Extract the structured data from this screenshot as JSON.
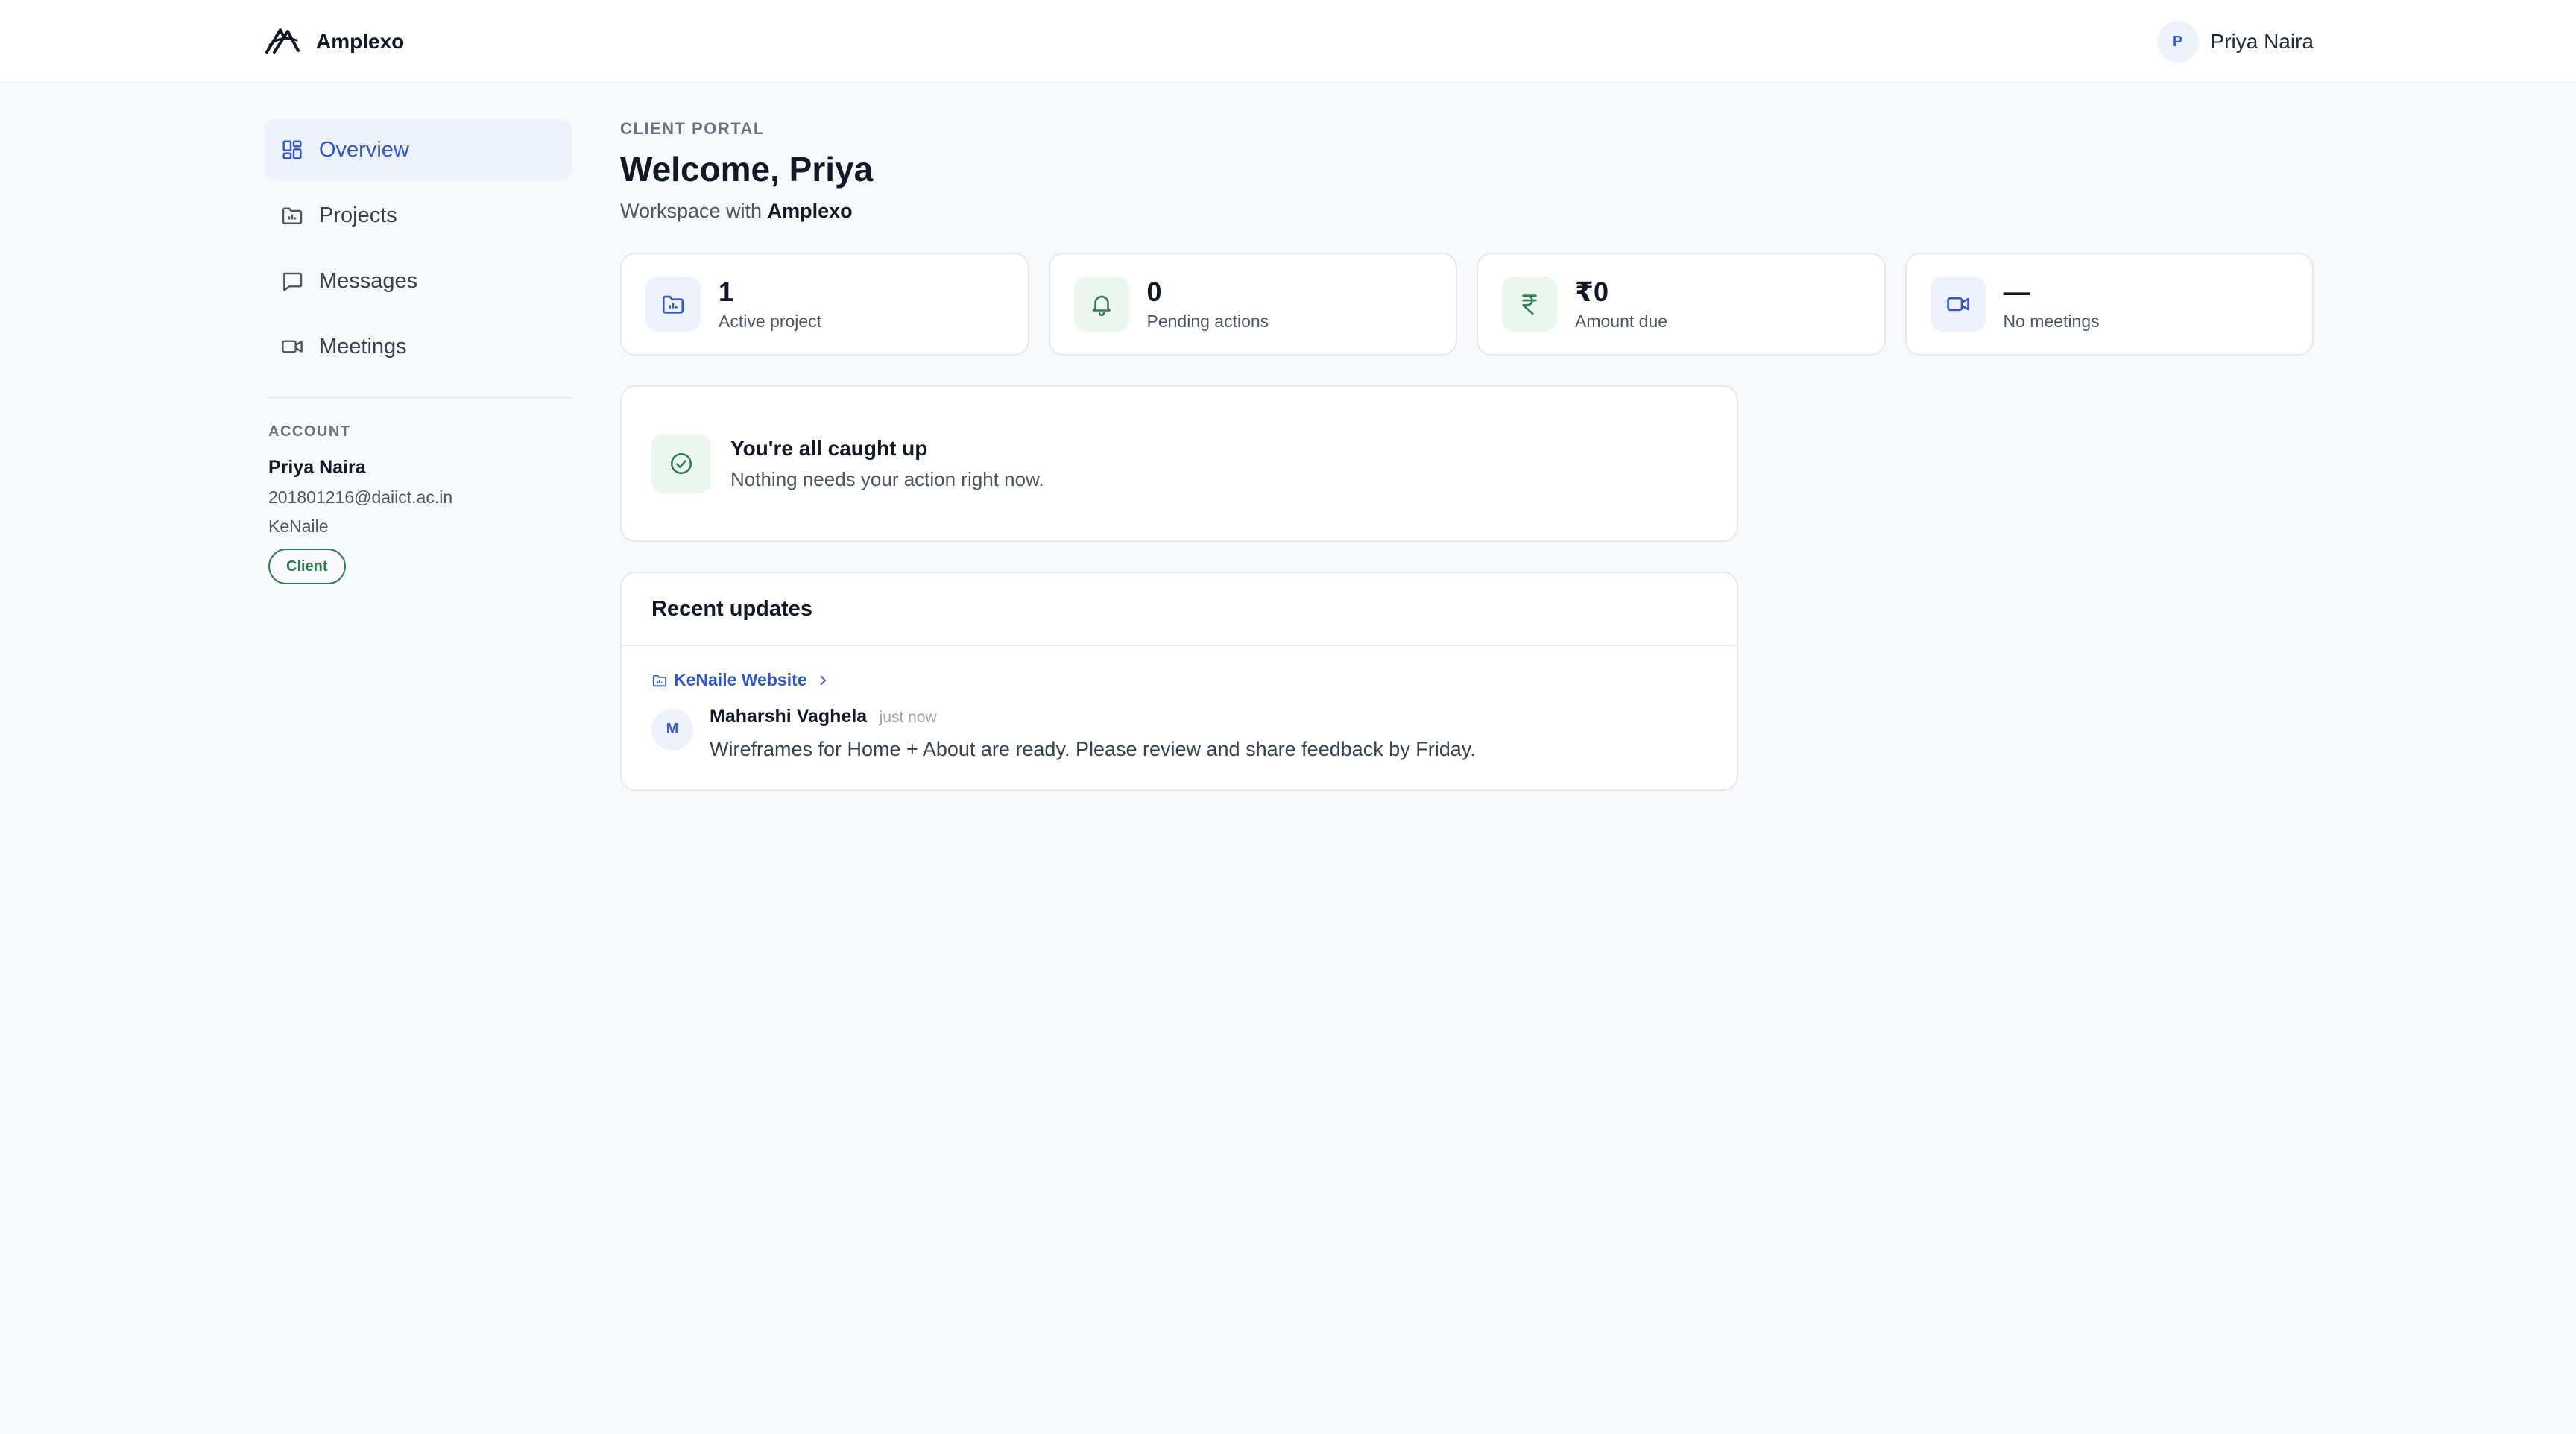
{
  "header": {
    "brand_name": "Amplexo",
    "user_initial": "P",
    "user_name": "Priya Naira"
  },
  "sidebar": {
    "items": [
      {
        "label": "Overview",
        "icon": "grid-icon",
        "active": true
      },
      {
        "label": "Projects",
        "icon": "folder-icon",
        "active": false
      },
      {
        "label": "Messages",
        "icon": "message-icon",
        "active": false
      },
      {
        "label": "Meetings",
        "icon": "video-icon",
        "active": false
      }
    ],
    "account": {
      "label": "ACCOUNT",
      "name": "Priya Naira",
      "email": "201801216@daiict.ac.in",
      "company": "KeNaile",
      "role_badge": "Client"
    }
  },
  "main": {
    "eyebrow": "CLIENT PORTAL",
    "title": "Welcome, Priya",
    "subtitle_prefix": "Workspace with",
    "subtitle_workspace": "Amplexo",
    "stats": [
      {
        "value": "1",
        "label": "Active project",
        "icon": "folder-icon",
        "tone": "blue"
      },
      {
        "value": "0",
        "label": "Pending actions",
        "icon": "bell-icon",
        "tone": "green"
      },
      {
        "value": "₹0",
        "label": "Amount due",
        "icon": "rupee-icon",
        "tone": "green"
      },
      {
        "value": "—",
        "label": "No meetings",
        "icon": "video-icon",
        "tone": "blue"
      }
    ],
    "caught_up": {
      "title": "You're all caught up",
      "subtitle": "Nothing needs your action right now."
    },
    "recent_updates": {
      "title": "Recent updates",
      "items": [
        {
          "project": "KeNaile Website",
          "author_initial": "M",
          "author": "Maharshi Vaghela",
          "time": "just now",
          "message": "Wireframes for Home + About are ready. Please review and share feedback by Friday."
        }
      ]
    }
  },
  "colors": {
    "accent": "#2d56d1",
    "success": "#2e7d4f",
    "background": "#f8f9fb"
  }
}
